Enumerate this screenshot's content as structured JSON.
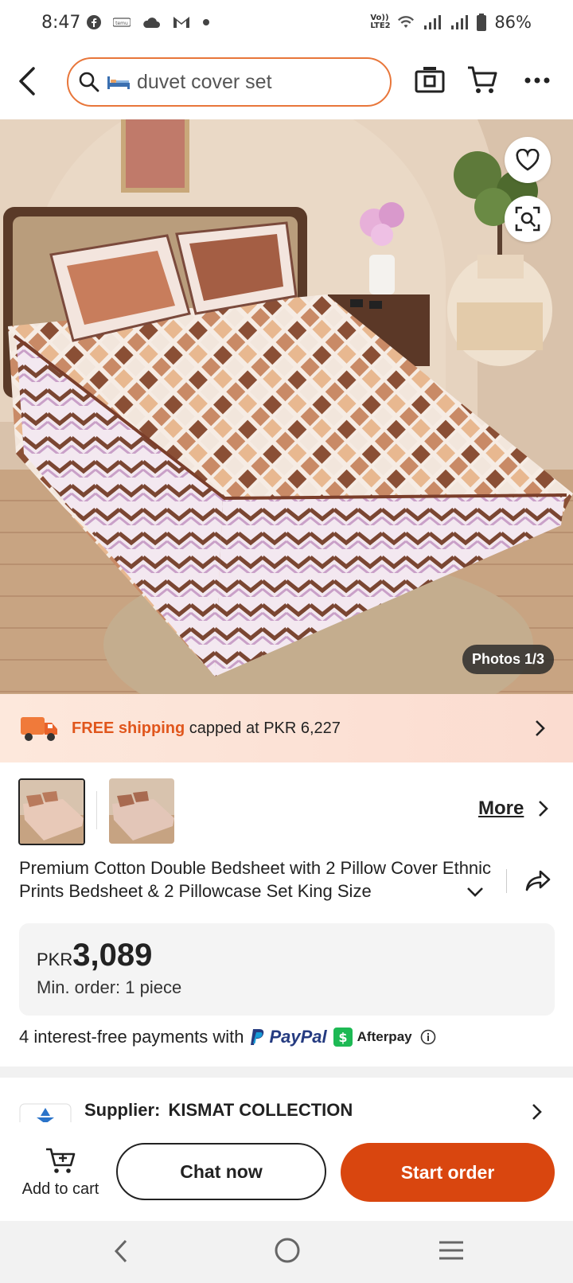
{
  "status_bar": {
    "time": "8:47",
    "network_label": "Vo)) LTE2",
    "battery": "86%",
    "icons": [
      "facebook-icon",
      "temu-icon",
      "cloud-icon",
      "gmail-icon",
      "dot-icon",
      "wifi-icon",
      "signal-icon",
      "signal-icon",
      "battery-icon"
    ]
  },
  "header": {
    "search_query": "duvet cover set",
    "icons": [
      "back-arrow-icon",
      "search-icon",
      "bed-emoji-icon",
      "camera-icon",
      "cart-icon",
      "more-icon"
    ]
  },
  "gallery": {
    "counter": "Photos 1/3",
    "icons": [
      "heart-icon",
      "visual-search-icon"
    ]
  },
  "shipping": {
    "free_label": "FREE shipping",
    "rest_label": "capped at PKR 6,227"
  },
  "thumbnails": {
    "more_label": "More",
    "count": 2,
    "selected_index": 0
  },
  "product": {
    "title": "Premium Cotton Double Bedsheet with 2 Pillow Cover Ethnic Prints Bedsheet & 2 Pillowcase Set King Size"
  },
  "price": {
    "currency": "PKR",
    "amount": "3,089",
    "min_order": "Min. order: 1 piece"
  },
  "payment": {
    "text": "4 interest-free payments with",
    "paypal": "PayPal",
    "afterpay": "Afterpay"
  },
  "supplier": {
    "label": "Supplier:",
    "name": "KISMAT COLLECTION"
  },
  "bottom_bar": {
    "add_to_cart": "Add to cart",
    "chat_now": "Chat now",
    "start_order": "Start order"
  },
  "colors": {
    "accent": "#d9460f",
    "search_border": "#e8763a",
    "free_shipping": "#e0561c",
    "paypal_blue": "#253b80",
    "afterpay_green": "#1db954"
  }
}
